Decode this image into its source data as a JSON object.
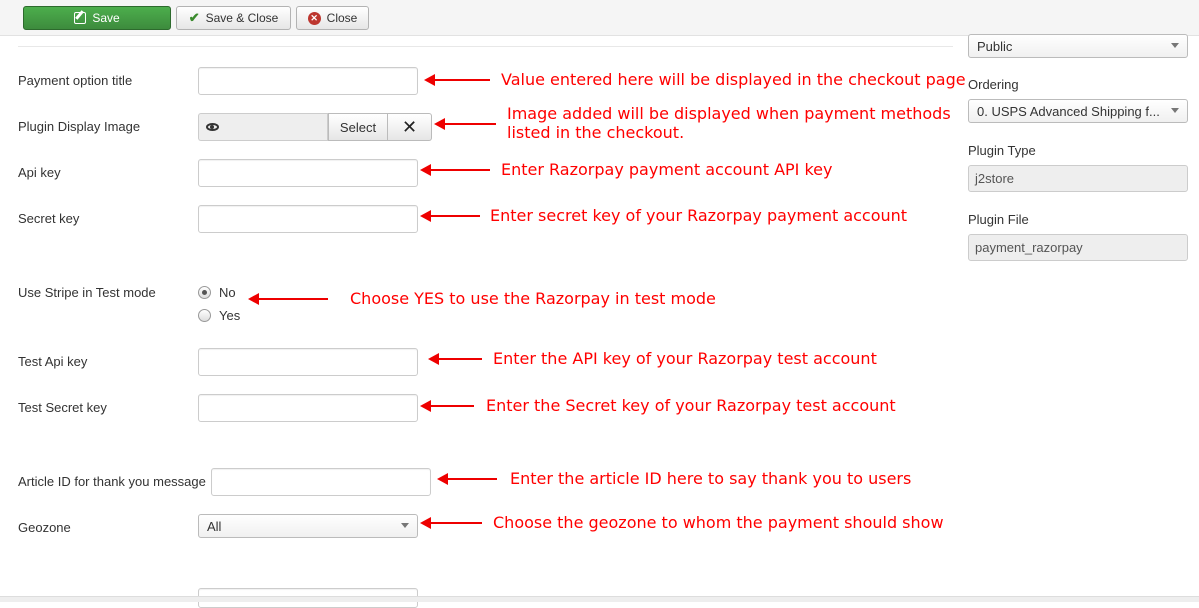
{
  "toolbar": {
    "save_label": "Save",
    "save_close_label": "Save & Close",
    "close_label": "Close"
  },
  "form": {
    "payment_option_title": {
      "label": "Payment option title",
      "value": ""
    },
    "plugin_display_image": {
      "label": "Plugin Display Image",
      "select_label": "Select"
    },
    "api_key": {
      "label": "Api key",
      "value": ""
    },
    "secret_key": {
      "label": "Secret key",
      "value": ""
    },
    "test_mode": {
      "label": "Use Stripe in Test mode",
      "options": [
        "No",
        "Yes"
      ],
      "selected": "No"
    },
    "test_api_key": {
      "label": "Test Api key",
      "value": ""
    },
    "test_secret_key": {
      "label": "Test Secret key",
      "value": ""
    },
    "article_id": {
      "label": "Article ID for thank you message",
      "value": ""
    },
    "geozone": {
      "label": "Geozone",
      "value": "All"
    }
  },
  "annotations": {
    "title": "Value entered here will be displayed in the checkout page",
    "image_line1": "Image added will be displayed when payment methods",
    "image_line2": "listed in the checkout.",
    "api_key": "Enter Razorpay payment account API key",
    "secret_key": "Enter secret key of your Razorpay payment account",
    "test_mode": "Choose YES to use the Razorpay in test mode",
    "test_api_key": "Enter the API key of your Razorpay test account",
    "test_secret_key": "Enter the Secret key of your Razorpay test account",
    "article_id": "Enter the article ID here to say thank you to users",
    "geozone": "Choose the geozone to whom the payment should show"
  },
  "sidebar": {
    "access_value": "Public",
    "ordering_label": "Ordering",
    "ordering_value": "0. USPS Advanced Shipping f...",
    "plugin_type_label": "Plugin Type",
    "plugin_type_value": "j2store",
    "plugin_file_label": "Plugin File",
    "plugin_file_value": "payment_razorpay"
  },
  "colors": {
    "annotation": "#ff0000",
    "save_button": "#46a546"
  },
  "icons": {
    "save": "edit-icon",
    "save_close": "check-icon",
    "close": "close-circle-icon",
    "preview": "eye-icon",
    "clear": "x-icon"
  }
}
